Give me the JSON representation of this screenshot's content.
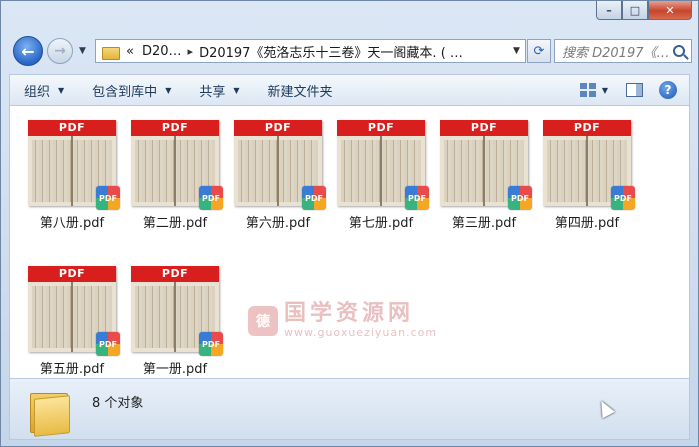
{
  "window": {
    "minimize_glyph": "–",
    "maximize_glyph": "□",
    "close_glyph": "✕"
  },
  "nav": {
    "back_icon": "arrow-left-icon",
    "forward_icon": "arrow-right-icon"
  },
  "address": {
    "prefix": "«",
    "crumbs": [
      "D20…",
      "D20197《苑洛志乐十三卷》天一阁藏本. ( …"
    ],
    "separator": "▸"
  },
  "search": {
    "placeholder": "搜索 D20197《…"
  },
  "toolbar": {
    "organize": "组织",
    "include_in_library": "包含到库中",
    "share": "共享",
    "new_folder": "新建文件夹"
  },
  "files": [
    {
      "name": "第八册.pdf",
      "thumb_label": "PDF"
    },
    {
      "name": "第二册.pdf",
      "thumb_label": "PDF"
    },
    {
      "name": "第六册.pdf",
      "thumb_label": "PDF"
    },
    {
      "name": "第七册.pdf",
      "thumb_label": "PDF"
    },
    {
      "name": "第三册.pdf",
      "thumb_label": "PDF"
    },
    {
      "name": "第四册.pdf",
      "thumb_label": "PDF"
    },
    {
      "name": "第五册.pdf",
      "thumb_label": "PDF"
    },
    {
      "name": "第一册.pdf",
      "thumb_label": "PDF"
    }
  ],
  "badge_label": "PDF",
  "watermark": {
    "seal": "德",
    "title": "国学资源网",
    "url": "www.guoxueziyuan.com"
  },
  "status": {
    "count_text": "8 个对象"
  },
  "colors": {
    "pdf_banner": "#d91e1e",
    "window_frame": "#c5d6ea"
  }
}
